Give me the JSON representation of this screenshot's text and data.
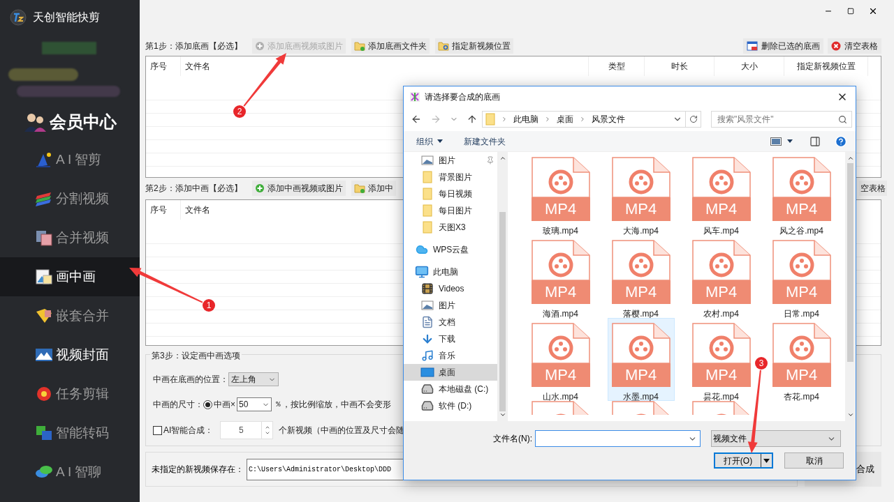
{
  "app": {
    "title": "天创智能快剪"
  },
  "sidebar": {
    "member": "会员中心",
    "items": [
      {
        "label": "A I 智剪",
        "kind": "wand",
        "selected": false,
        "bright": false
      },
      {
        "label": "分割视频",
        "kind": "layers",
        "selected": false,
        "bright": false
      },
      {
        "label": "合并视频",
        "kind": "films",
        "selected": false,
        "bright": false
      },
      {
        "label": "画中画",
        "kind": "pictures",
        "selected": true,
        "bright": true
      },
      {
        "label": "嵌套合并",
        "kind": "box",
        "selected": false,
        "bright": false
      },
      {
        "label": "视频封面",
        "kind": "landscape",
        "selected": false,
        "bright": true
      },
      {
        "label": "任务剪辑",
        "kind": "flower",
        "selected": false,
        "bright": false
      },
      {
        "label": "智能转码",
        "kind": "convert",
        "selected": false,
        "bright": false
      },
      {
        "label": "A I 智聊",
        "kind": "chat",
        "selected": false,
        "bright": false
      }
    ]
  },
  "step1": {
    "label": "第1步：添加底画【必选】",
    "buttons": [
      {
        "label": "添加底画视频或图片",
        "kind": "add",
        "disabled": true
      },
      {
        "label": "添加底画文件夹",
        "kind": "folder",
        "disabled": false
      },
      {
        "label": "指定新视频位置",
        "kind": "locate",
        "disabled": false
      }
    ],
    "right_buttons": [
      {
        "label": "删除已选的底画",
        "kind": "delete"
      },
      {
        "label": "清空表格",
        "kind": "clear"
      }
    ],
    "columns": [
      "序号",
      "文件名",
      "类型",
      "时长",
      "大小",
      "指定新视频位置"
    ]
  },
  "step2": {
    "label": "第2步：添加中画【必选】",
    "buttons": [
      {
        "label": "添加中画视频或图片",
        "kind": "add",
        "disabled": false
      },
      {
        "label": "添加中",
        "kind": "folder",
        "disabled": false
      }
    ],
    "right_buttons": [
      {
        "label": "空表格",
        "kind": "text"
      }
    ],
    "columns": [
      "序号",
      "文件名"
    ]
  },
  "step3": {
    "legend": "第3步：设定画中画选项",
    "position_label": "中画在底画的位置：",
    "position_value": "左上角",
    "size_label": "中画的尺寸：",
    "size_radio": {
      "label": "中画×",
      "selected": true
    },
    "size_value": "50",
    "size_unit": "%",
    "size_note": "，按比例缩放，中画不会变形",
    "ai": {
      "label": "AI智能合成：",
      "checked": false,
      "count": "5",
      "suffix": "个新视频（中画的位置及尺寸会随"
    }
  },
  "save": {
    "label": "未指定的新视频保存在：",
    "value": "C:\\Users\\Administrator\\Desktop\\DDD"
  },
  "start_button": "合成",
  "dialog": {
    "title": "请选择要合成的底画",
    "breadcrumbs": [
      "此电脑",
      "桌面",
      "风景文件"
    ],
    "search_placeholder": "搜索\"风景文件\"",
    "toolbar": [
      "组织",
      "新建文件夹"
    ],
    "quick_access": [
      {
        "label": "图片",
        "kind": "pictures",
        "pinned": true
      },
      {
        "label": "背景图片",
        "kind": "folder",
        "pinned": false
      },
      {
        "label": "每日视频",
        "kind": "folder",
        "pinned": false
      },
      {
        "label": "每日图片",
        "kind": "folder",
        "pinned": false
      },
      {
        "label": "天图X3",
        "kind": "folder",
        "pinned": false
      }
    ],
    "tree": [
      {
        "label": "WPS云盘",
        "kind": "cloud",
        "selected": false
      },
      {
        "label": "此电脑",
        "kind": "computer",
        "selected": false,
        "children": [
          {
            "label": "Videos",
            "kind": "videos",
            "selected": false
          },
          {
            "label": "图片",
            "kind": "pictures",
            "selected": false
          },
          {
            "label": "文档",
            "kind": "documents",
            "selected": false
          },
          {
            "label": "下载",
            "kind": "downloads",
            "selected": false
          },
          {
            "label": "音乐",
            "kind": "music",
            "selected": false
          },
          {
            "label": "桌面",
            "kind": "desktop",
            "selected": true
          },
          {
            "label": "本地磁盘 (C:)",
            "kind": "drive",
            "selected": false
          },
          {
            "label": "软件 (D:)",
            "kind": "drive",
            "selected": false
          }
        ]
      }
    ],
    "files": [
      {
        "kind": "file",
        "name": "玻璃.mp4",
        "badge": "MP4",
        "selected": false
      },
      {
        "kind": "file",
        "name": "大海.mp4",
        "badge": "MP4",
        "selected": false
      },
      {
        "kind": "file",
        "name": "风车.mp4",
        "badge": "MP4",
        "selected": false
      },
      {
        "kind": "file",
        "name": "风之谷.mp4",
        "badge": "MP4",
        "selected": false
      },
      {
        "kind": "file",
        "name": "海酒.mp4",
        "badge": "MP4",
        "selected": false
      },
      {
        "kind": "file",
        "name": "落樱.mp4",
        "badge": "MP4",
        "selected": false
      },
      {
        "kind": "file",
        "name": "农村.mp4",
        "badge": "MP4",
        "selected": false
      },
      {
        "kind": "file",
        "name": "日常.mp4",
        "badge": "MP4",
        "selected": false
      },
      {
        "kind": "file",
        "name": "山水.mp4",
        "badge": "MP4",
        "selected": false
      },
      {
        "kind": "file",
        "name": "水墨.mp4",
        "badge": "MP4",
        "selected": true
      },
      {
        "kind": "file",
        "name": "昙花.mp4",
        "badge": "MP4",
        "selected": false
      },
      {
        "kind": "file",
        "name": "杏花.mp4",
        "badge": "MP4",
        "selected": false
      },
      {
        "kind": "partial"
      },
      {
        "kind": "partial"
      },
      {
        "kind": "partial"
      }
    ],
    "filename_label": "文件名(N):",
    "filetype": "视频文件",
    "open_button": "打开(O)",
    "cancel_button": "取消"
  },
  "annotations": [
    {
      "number": "1"
    },
    {
      "number": "2"
    },
    {
      "number": "3"
    }
  ]
}
